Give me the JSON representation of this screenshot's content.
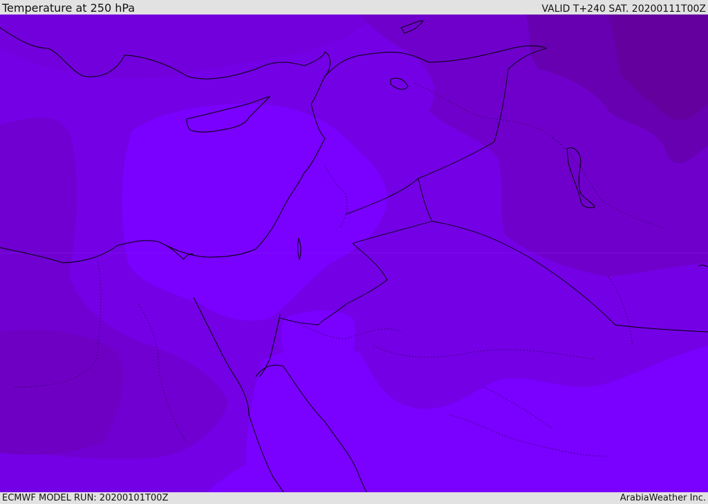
{
  "header": {
    "title": "Temperature at 250 hPa",
    "valid_time": "VALID T+240 SAT. 20200111T00Z"
  },
  "footer": {
    "model_run": "ECMWF MODEL RUN: 20200101T00Z",
    "credit": "ArabiaWeather Inc."
  },
  "map": {
    "field": "temperature",
    "level": "250 hPa",
    "colors": {
      "warmest": "#7a00ff",
      "warm": "#7400e6",
      "cool": "#7000d2",
      "coolest": "#6a00b4",
      "darkest": "#63009e",
      "coastline": "#000000",
      "border": "#1a0033"
    }
  }
}
